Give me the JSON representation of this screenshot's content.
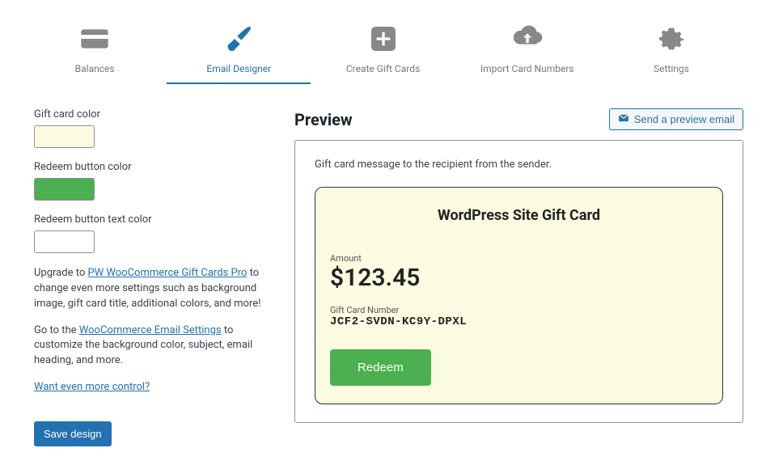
{
  "tabs": {
    "balances": "Balances",
    "email_designer": "Email Designer",
    "create": "Create Gift Cards",
    "import": "Import Card Numbers",
    "settings": "Settings"
  },
  "sidebar": {
    "gift_card_color_label": "Gift card color",
    "gift_card_color": "#fbfbe1",
    "redeem_button_color_label": "Redeem button color",
    "redeem_button_color": "#4caf50",
    "redeem_button_text_color_label": "Redeem button text color",
    "redeem_button_text_color": "#ffffff",
    "upgrade_prefix": "Upgrade to ",
    "upgrade_link": "PW WooCommerce Gift Cards Pro",
    "upgrade_suffix": " to change even more settings such as background image, gift card title, additional colors, and more!",
    "goto_prefix": "Go to the ",
    "goto_link": "WooCommerce Email Settings",
    "goto_suffix": " to customize the background color, subject, email heading, and more.",
    "more_control": "Want even more control?",
    "save": "Save design"
  },
  "preview": {
    "heading": "Preview",
    "send_button": "Send a preview email",
    "message": "Gift card message to the recipient from the sender.",
    "card_title": "WordPress Site Gift Card",
    "amount_label": "Amount",
    "amount": "$123.45",
    "number_label": "Gift Card Number",
    "number": "JCF2-SVDN-KC9Y-DPXL",
    "redeem": "Redeem"
  }
}
